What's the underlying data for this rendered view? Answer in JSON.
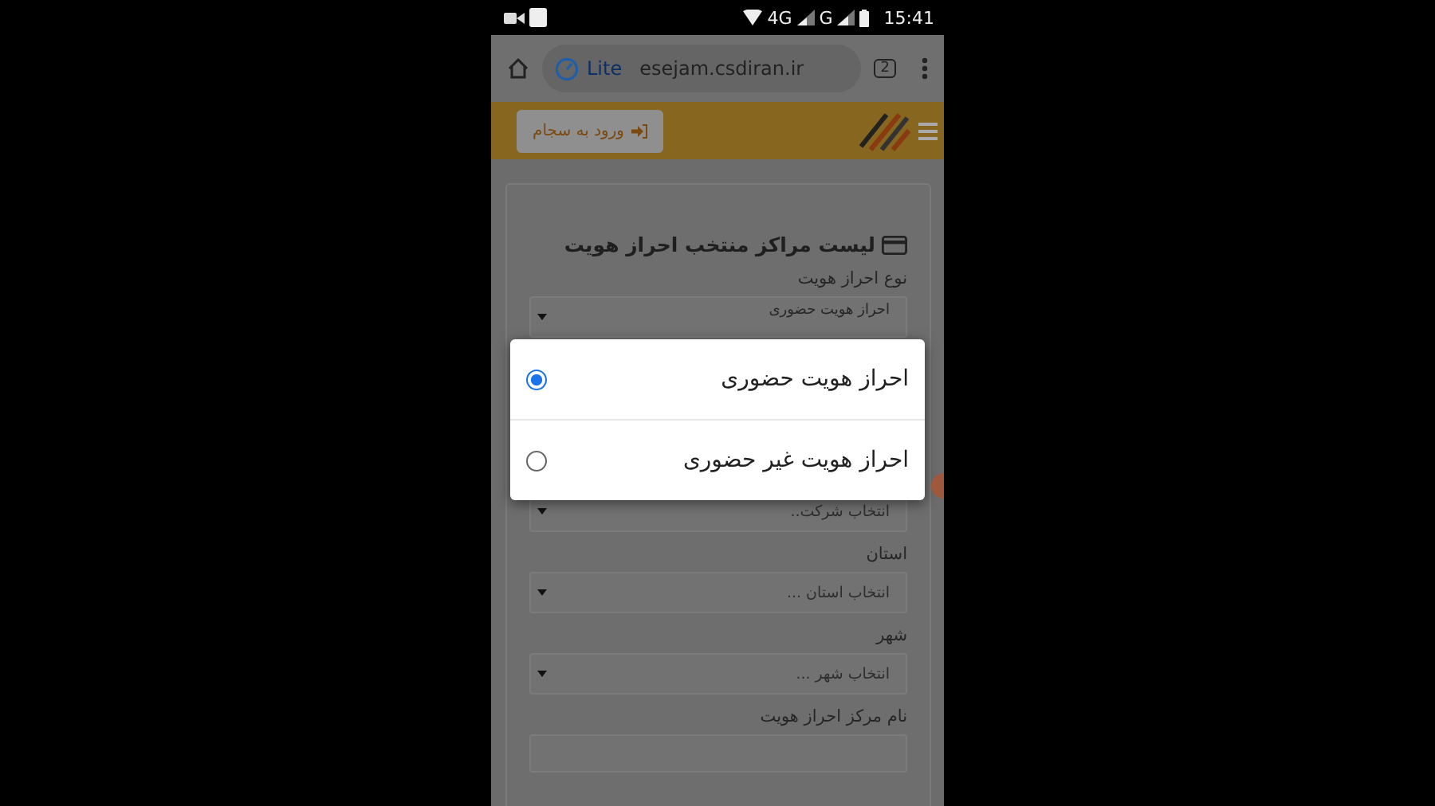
{
  "status_bar": {
    "network": "4G",
    "network_2": "G",
    "time": "15:41"
  },
  "browser": {
    "lite_label": "Lite",
    "url": "esejam.csdiran.ir",
    "tab_count": "2"
  },
  "header": {
    "login_button": "ورود به سجام"
  },
  "card": {
    "title": "لیست مراکز منتخب احراز هویت",
    "fields": [
      {
        "label": "نوع احراز هویت",
        "kind": "select",
        "value": "احراز هویت حضوری"
      },
      {
        "kind": "select",
        "placeholder": "انتخاب شرکت.."
      },
      {
        "label": "استان",
        "kind": "select",
        "placeholder": "انتخاب استان ..."
      },
      {
        "label": "شهر",
        "kind": "select",
        "placeholder": "انتخاب شهر ..."
      },
      {
        "label": "نام مرکز احراز هویت",
        "kind": "text"
      }
    ]
  },
  "dialog": {
    "options": [
      {
        "label": "احراز هویت حضوری",
        "selected": true
      },
      {
        "label": "احراز هویت غیر حضوری",
        "selected": false
      }
    ]
  }
}
